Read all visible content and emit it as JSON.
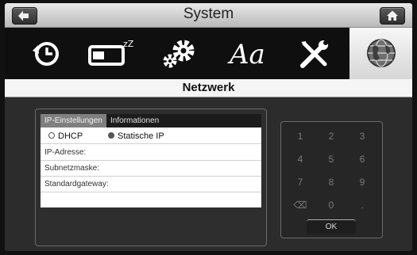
{
  "header": {
    "title": "System",
    "back_icon": "arrow-left-icon",
    "home_icon": "home-icon"
  },
  "categories": [
    {
      "name": "history-clock-icon"
    },
    {
      "name": "sleep-battery-icon"
    },
    {
      "name": "gears-icon"
    },
    {
      "name": "font-icon",
      "glyph": "Aa"
    },
    {
      "name": "tools-icon"
    },
    {
      "name": "network-globe-icon",
      "selected": true
    }
  ],
  "section": {
    "title": "Netzwerk"
  },
  "tabs": [
    {
      "label": "IP-Einstellungen",
      "active": true
    },
    {
      "label": "Informationen",
      "active": false
    }
  ],
  "form": {
    "mode_options": [
      {
        "label": "DHCP",
        "selected": false
      },
      {
        "label": "Statische IP",
        "selected": true
      }
    ],
    "fields": [
      {
        "label": "IP-Adresse:",
        "value": ""
      },
      {
        "label": "Subnetzmaske:",
        "value": ""
      },
      {
        "label": "Standardgateway:",
        "value": ""
      }
    ]
  },
  "keypad": {
    "keys": [
      "1",
      "2",
      "3",
      "4",
      "5",
      "6",
      "7",
      "8",
      "9",
      "⌫",
      "0",
      "."
    ],
    "ok_label": "OK"
  },
  "colors": {
    "accent": "#7f7f7f",
    "background": "#2c2c2c",
    "title_bar": "#d0d0d0"
  }
}
